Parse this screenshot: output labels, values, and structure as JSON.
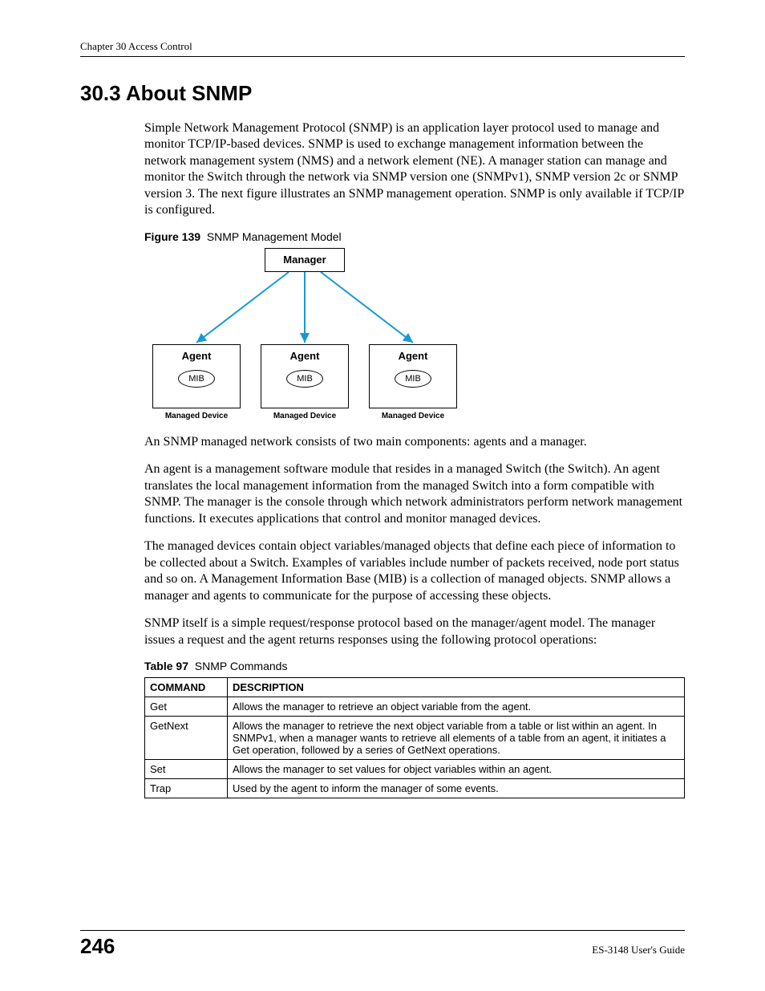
{
  "header": {
    "chapter": "Chapter 30 Access Control"
  },
  "section": {
    "number_title": "30.3  About SNMP"
  },
  "paragraphs": {
    "p1": "Simple Network Management Protocol (SNMP) is an application layer protocol used to manage and monitor TCP/IP-based devices. SNMP is used to exchange management information between the network management system (NMS) and a network element (NE). A manager station can manage and monitor the Switch through the network via SNMP version one (SNMPv1), SNMP version 2c or SNMP version 3. The next figure illustrates an SNMP management operation. SNMP is only available if TCP/IP is configured.",
    "p2": "An SNMP managed network consists of two main components: agents and a manager.",
    "p3": "An agent is a management software module that resides in a managed Switch (the Switch). An agent translates the local management information from the managed Switch into a form compatible with SNMP. The manager is the console through which network administrators perform network management functions. It executes applications that control and monitor managed devices.",
    "p4": "The managed devices contain object variables/managed objects that define each piece of information to be collected about a Switch. Examples of variables include number of packets received, node port status and so on. A Management Information Base (MIB) is a collection of managed objects. SNMP allows a manager and agents to communicate for the purpose of accessing these objects.",
    "p5": "SNMP itself is a simple request/response protocol based on the manager/agent model. The manager issues a request and the agent returns responses using the following protocol operations:"
  },
  "figure": {
    "label": "Figure 139",
    "title": "SNMP Management Model",
    "manager": "Manager",
    "agent": "Agent",
    "mib": "MIB",
    "managed_device": "Managed Device"
  },
  "table": {
    "label": "Table 97",
    "title": "SNMP Commands",
    "headers": {
      "c1": "COMMAND",
      "c2": "DESCRIPTION"
    },
    "rows": [
      {
        "cmd": "Get",
        "desc": "Allows the manager to retrieve an object variable from the agent."
      },
      {
        "cmd": "GetNext",
        "desc": "Allows the manager to retrieve the next object variable from a table or list within an agent. In SNMPv1, when a manager wants to retrieve all elements of a table from an agent, it initiates a Get operation, followed by a series of GetNext operations."
      },
      {
        "cmd": "Set",
        "desc": "Allows the manager to set values for object variables within an agent."
      },
      {
        "cmd": "Trap",
        "desc": "Used by the agent to inform the manager of some events."
      }
    ]
  },
  "footer": {
    "page": "246",
    "guide": "ES-3148 User's Guide"
  }
}
